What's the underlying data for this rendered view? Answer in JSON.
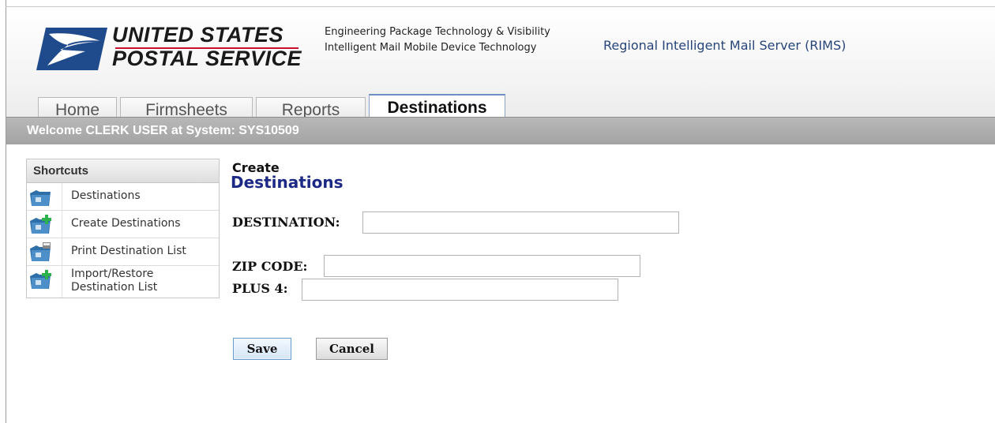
{
  "app": {
    "brand": {
      "line1": "UNITED STATES",
      "line2": "POSTAL SERVICE"
    },
    "subtitle": {
      "line1": "Engineering Package Technology & Visibility",
      "line2": "Intelligent Mail Mobile Device Technology"
    },
    "system_title": "Regional Intelligent Mail Server (RIMS)",
    "colors": {
      "brand_blue": "#1f4a8c",
      "brand_red": "#c8102e",
      "heading_blue": "#1c2a86"
    }
  },
  "tabs": [
    {
      "label": "Home",
      "active": false
    },
    {
      "label": "Firmsheets",
      "active": false
    },
    {
      "label": "Reports",
      "active": false
    },
    {
      "label": "Destinations",
      "active": true
    }
  ],
  "welcome": {
    "text": "Welcome CLERK USER at System: SYS10509"
  },
  "shortcuts": {
    "title": "Shortcuts",
    "items": [
      {
        "label": "Destinations",
        "icon": "folder-icon"
      },
      {
        "label": "Create Destinations",
        "icon": "folder-add-icon"
      },
      {
        "label": "Print Destination List",
        "icon": "folder-print-icon"
      },
      {
        "label": "Import/Restore Destination List",
        "icon": "folder-import-icon"
      }
    ]
  },
  "form": {
    "heading_small": "Create",
    "heading_big": "Destinations",
    "destination": {
      "label": "DESTINATION:",
      "value": ""
    },
    "zip_code": {
      "label": "ZIP CODE:",
      "value": ""
    },
    "plus4": {
      "label": "PLUS 4:",
      "value": ""
    },
    "save_label": "Save",
    "cancel_label": "Cancel"
  }
}
